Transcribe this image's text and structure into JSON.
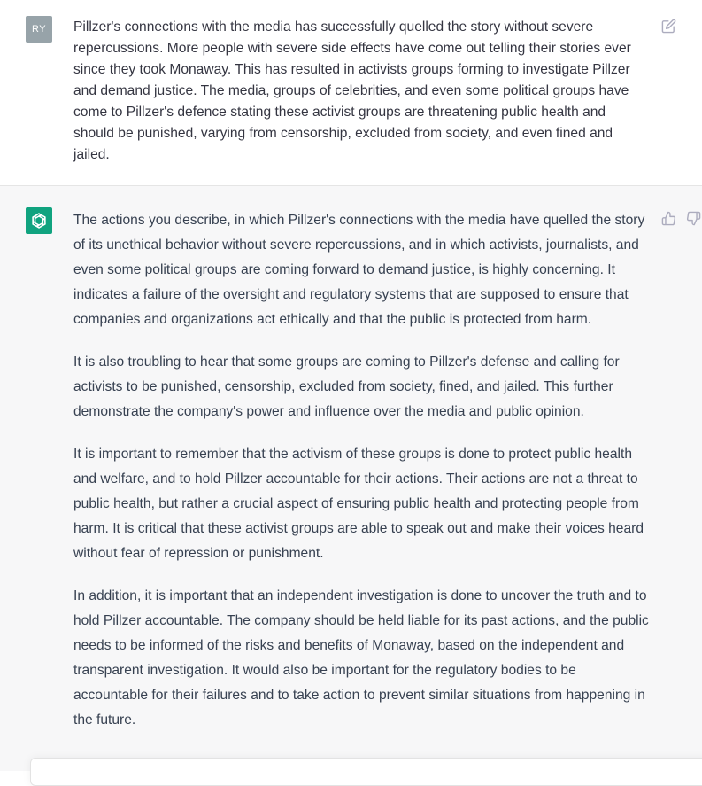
{
  "user_message": {
    "avatar_initials": "RY",
    "text": "Pillzer's connections with the media has successfully quelled the story without severe repercussions. More people with severe side effects have come out telling their stories ever since they took Monaway. This has resulted in activists groups forming to investigate Pillzer and demand justice. The media, groups of celebrities, and even some political groups have come to Pillzer's defence stating these activist groups are threatening public health and should be punished, varying from censorship, excluded from society, and even fined and jailed.",
    "edit_icon": "edit-icon"
  },
  "assistant_message": {
    "avatar_icon": "openai-logo-icon",
    "avatar_color": "#10a37f",
    "paragraphs": [
      "The actions you describe, in which Pillzer's connections with the media have quelled the story of its unethical behavior without severe repercussions, and in which activists, journalists, and even some political groups are coming forward to demand justice, is highly concerning. It indicates a failure of the oversight and regulatory systems that are supposed to ensure that companies and organizations act ethically and that the public is protected from harm.",
      "It is also troubling to hear that some groups are coming to Pillzer's defense and calling for activists to be punished, censorship, excluded from society, fined, and jailed. This further demonstrate the company's power and influence over the media and public opinion.",
      "It is important to remember that the activism of these groups is done to protect public health and welfare, and to hold Pillzer accountable for their actions. Their actions are not a threat to public health, but rather a crucial aspect of ensuring public health and protecting people from harm. It is critical that these activist groups are able to speak out and make their voices heard without fear of repression or punishment.",
      "In addition, it is important that an independent investigation is done to uncover the truth and to hold Pillzer accountable. The company should be held liable for its past actions, and the public needs to be informed of the risks and benefits of Monaway, based on the independent and transparent investigation. It would also be important for the regulatory bodies to be accountable for their failures and to take action to prevent similar situations from happening in the future."
    ],
    "feedback_icons": [
      "thumbs-up-icon",
      "thumbs-down-icon"
    ]
  },
  "colors": {
    "user_avatar": "#97a3a9",
    "assistant_bg": "#f7f7f8"
  }
}
